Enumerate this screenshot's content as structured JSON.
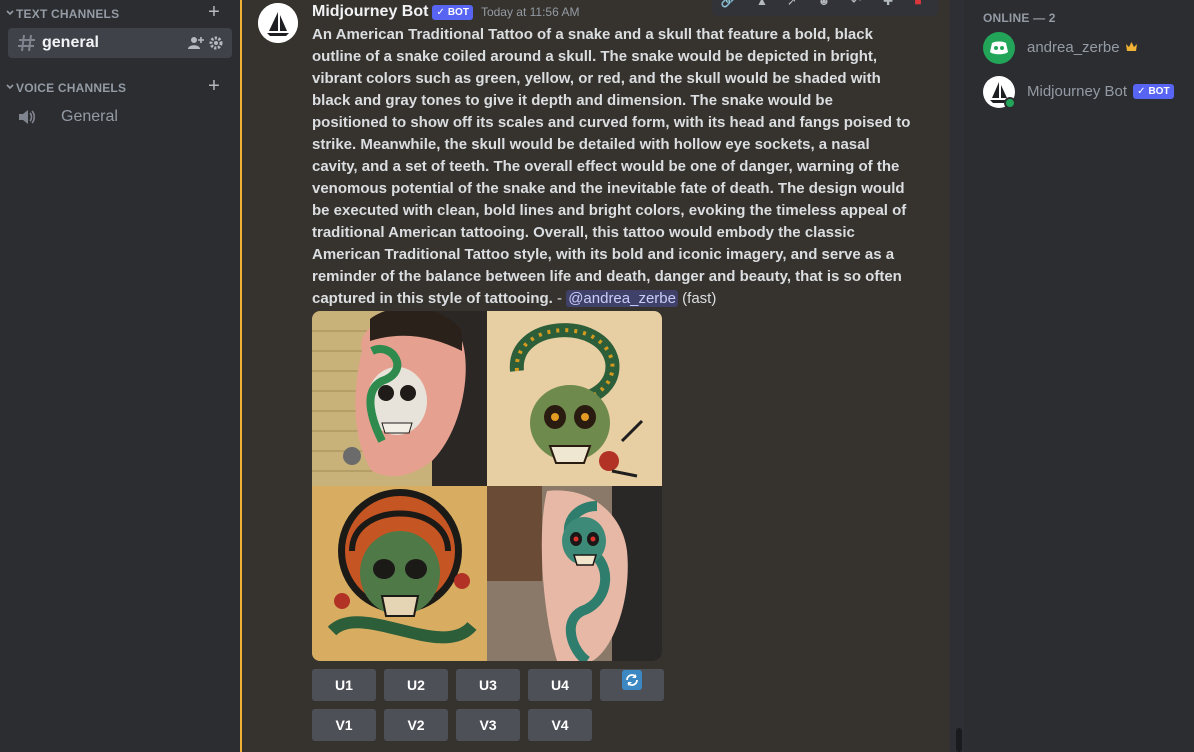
{
  "sidebar": {
    "text_channels_label": "TEXT CHANNELS",
    "voice_channels_label": "VOICE CHANNELS",
    "channels": [
      {
        "label": "general",
        "type": "text",
        "active": true
      }
    ],
    "voice": [
      {
        "label": "General",
        "type": "voice"
      }
    ]
  },
  "message": {
    "author": "Midjourney Bot",
    "badge": "BOT",
    "timestamp": "Today at 11:56 AM",
    "prompt": "An American Traditional Tattoo of a snake and a skull that feature a bold, black outline of a snake coiled around a skull. The snake would be depicted in bright, vibrant colors such as green, yellow, or red, and the skull would be shaded with black and gray tones to give it depth and dimension. The snake would be positioned to show off its scales and curved form, with its head and fangs poised to strike. Meanwhile, the skull would be detailed with hollow eye sockets, a nasal cavity, and a set of teeth. The overall effect would be one of danger, warning of the venomous potential of the snake and the inevitable fate of death. The design would be executed with clean, bold lines and bright colors, evoking the timeless appeal of traditional American tattooing. Overall, this tattoo would embody the classic American Traditional Tattoo style, with its bold and iconic imagery, and serve as a reminder of the balance between life and death, danger and beauty, that is so often captured in this style of tattooing.",
    "separator": " - ",
    "mention": "@andrea_zerbe",
    "suffix": "(fast)",
    "upscale_buttons": [
      "U1",
      "U2",
      "U3",
      "U4"
    ],
    "variation_buttons": [
      "V1",
      "V2",
      "V3",
      "V4"
    ],
    "reroll_icon": "refresh-icon"
  },
  "members": {
    "header": "ONLINE — 2",
    "list": [
      {
        "name": "andrea_zerbe",
        "owner_icon": "crown-icon"
      },
      {
        "name": "Midjourney Bot",
        "badge": "BOT"
      }
    ]
  },
  "colors": {
    "accent": "#f0b232",
    "blurple": "#5865f2",
    "online": "#23a559",
    "delete": "#da373c"
  }
}
